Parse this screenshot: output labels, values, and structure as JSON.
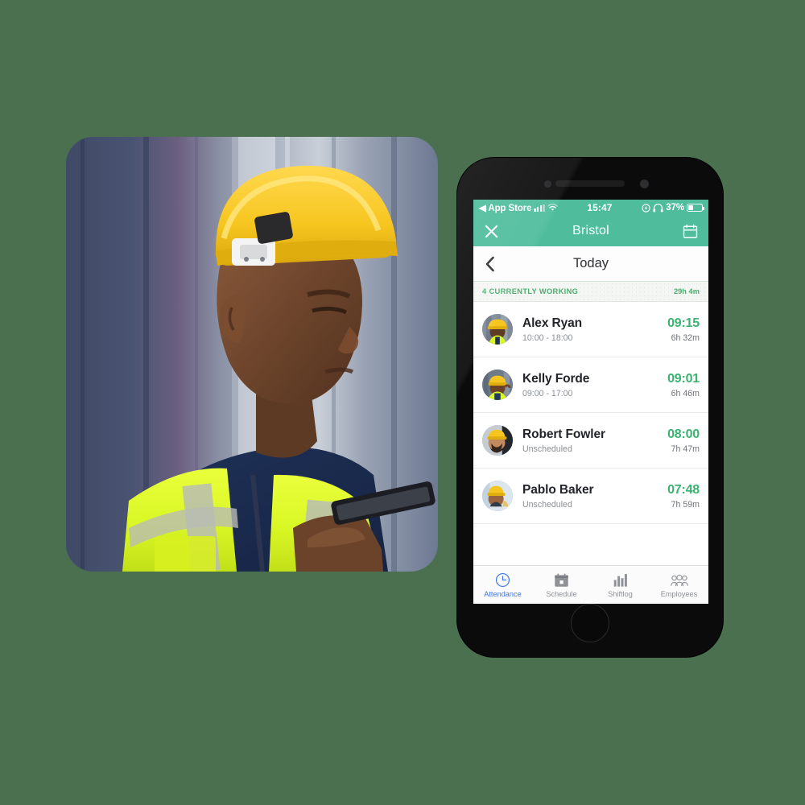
{
  "theme": {
    "page_background": "#4a7050",
    "accent_teal": "#4fbd9c",
    "accent_green": "#3cb371",
    "tab_active_blue": "#3b76e8"
  },
  "photo": {
    "alt": "Construction worker in yellow hard hat and hi-vis vest using a phone"
  },
  "phone": {
    "status_bar": {
      "carrier_back": "◀ App Store",
      "signal_icon": "signal-bars-icon",
      "wifi_icon": "wifi-icon",
      "time": "15:47",
      "location_icon": "location-icon",
      "headphones_icon": "headphones-icon",
      "battery_percent": "37%",
      "battery_icon": "battery-icon"
    },
    "navbar": {
      "close_icon": "close-icon",
      "title": "Bristol",
      "calendar_icon": "calendar-icon"
    },
    "today_bar": {
      "back_icon": "chevron-left-icon",
      "title": "Today"
    },
    "section_header": {
      "label": "4 CURRENTLY WORKING",
      "total": "29h 4m"
    },
    "rows": [
      {
        "avatar": "avatar-icon",
        "name": "Alex Ryan",
        "schedule": "10:00 - 18:00",
        "time": "09:15",
        "duration": "6h 32m"
      },
      {
        "avatar": "avatar-icon",
        "name": "Kelly Forde",
        "schedule": "09:00 - 17:00",
        "time": "09:01",
        "duration": "6h 46m"
      },
      {
        "avatar": "avatar-icon",
        "name": "Robert Fowler",
        "schedule": "Unscheduled",
        "time": "08:00",
        "duration": "7h 47m"
      },
      {
        "avatar": "avatar-icon",
        "name": "Pablo Baker",
        "schedule": "Unscheduled",
        "time": "07:48",
        "duration": "7h 59m"
      }
    ],
    "tabs": [
      {
        "label": "Attendance",
        "icon": "clock-icon",
        "active": true
      },
      {
        "label": "Schedule",
        "icon": "calendar-icon",
        "active": false
      },
      {
        "label": "Shiftlog",
        "icon": "bar-chart-icon",
        "active": false
      },
      {
        "label": "Employees",
        "icon": "people-icon",
        "active": false
      }
    ]
  }
}
